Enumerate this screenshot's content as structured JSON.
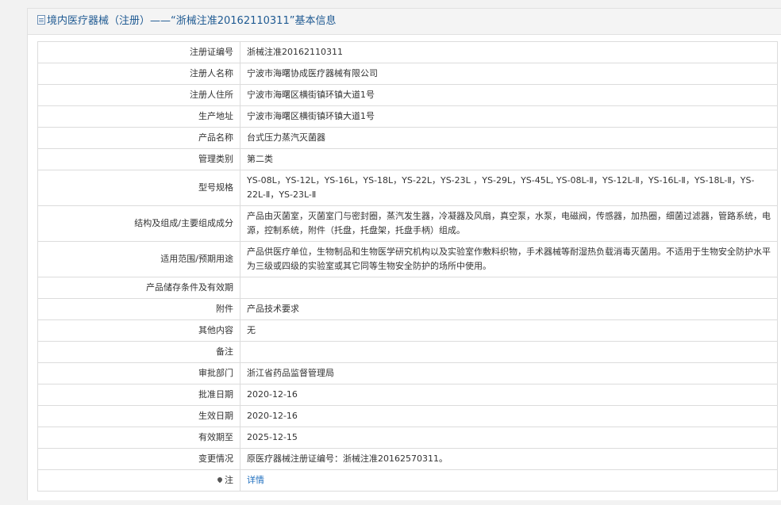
{
  "header": {
    "title": "境内医疗器械（注册）——“浙械注准20162110311”基本信息",
    "icon": "document-icon"
  },
  "rows": [
    {
      "label": "注册证编号",
      "value": "浙械注准20162110311"
    },
    {
      "label": "注册人名称",
      "value": "宁波市海曙协成医疗器械有限公司"
    },
    {
      "label": "注册人住所",
      "value": "宁波市海曙区横街镇环镇大道1号"
    },
    {
      "label": "生产地址",
      "value": "宁波市海曙区横街镇环镇大道1号"
    },
    {
      "label": "产品名称",
      "value": "台式压力蒸汽灭菌器"
    },
    {
      "label": "管理类别",
      "value": "第二类"
    },
    {
      "label": "型号规格",
      "value": "YS-08L，YS-12L，YS-16L，YS-18L，YS-22L，YS-23L ，YS-29L，YS-45L, YS-08L-Ⅱ，YS-12L-Ⅱ，YS-16L-Ⅱ，YS-18L-Ⅱ，YS-22L-Ⅱ，YS-23L-Ⅱ"
    },
    {
      "label": "结构及组成/主要组成成分",
      "value": "产品由灭菌室，灭菌室门与密封圈，蒸汽发生器，冷凝器及风扇，真空泵，水泵，电磁阀，传感器，加热圈，细菌过滤器，管路系统，电源，控制系统，附件（托盘，托盘架，托盘手柄）组成。"
    },
    {
      "label": "适用范围/预期用途",
      "value": "产品供医疗单位，生物制品和生物医学研究机构以及实验室作敷料织物，手术器械等耐湿热负载消毒灭菌用。不适用于生物安全防护水平为三级或四级的实验室或其它同等生物安全防护的场所中使用。"
    },
    {
      "label": "产品储存条件及有效期",
      "value": ""
    },
    {
      "label": "附件",
      "value": "产品技术要求"
    },
    {
      "label": "其他内容",
      "value": "无"
    },
    {
      "label": "备注",
      "value": ""
    },
    {
      "label": "审批部门",
      "value": "浙江省药品监督管理局"
    },
    {
      "label": "批准日期",
      "value": "2020-12-16"
    },
    {
      "label": "生效日期",
      "value": "2020-12-16"
    },
    {
      "label": "有效期至",
      "value": "2025-12-15"
    },
    {
      "label": "变更情况",
      "value": "原医疗器械注册证编号：浙械注准20162570311。"
    },
    {
      "label": "注",
      "value": "详情",
      "icon": "pin-icon"
    }
  ],
  "colors": {
    "title": "#1f5a92",
    "link": "#1f6fbf",
    "border": "#dcdcdc"
  }
}
